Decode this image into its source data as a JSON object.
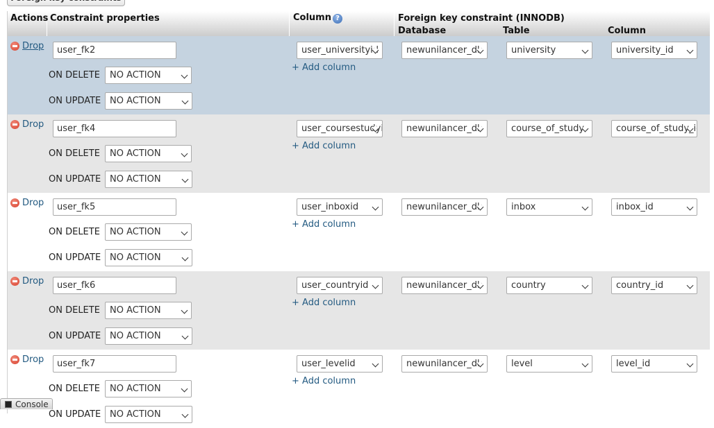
{
  "top_tab_label": "Foreign key constraints",
  "header": {
    "actions": "Actions",
    "constraint_properties": "Constraint properties",
    "column": "Column",
    "fk_title": "Foreign key constraint (INNODB)",
    "database": "Database",
    "table": "Table",
    "ref_column": "Column"
  },
  "labels": {
    "drop": "Drop",
    "on_delete": "ON DELETE",
    "on_update": "ON UPDATE",
    "add_column": "+ Add column"
  },
  "rows": [
    {
      "name": "user_fk2",
      "on_delete": "NO ACTION",
      "on_update": "NO ACTION",
      "column": "user_universityid",
      "database": "newunilancer_db",
      "table": "university",
      "ref_column": "university_id"
    },
    {
      "name": "user_fk4",
      "on_delete": "NO ACTION",
      "on_update": "NO ACTION",
      "column": "user_coursestudyid",
      "database": "newunilancer_db",
      "table": "course_of_study",
      "ref_column": "course_of_study_id"
    },
    {
      "name": "user_fk5",
      "on_delete": "NO ACTION",
      "on_update": "NO ACTION",
      "column": "user_inboxid",
      "database": "newunilancer_db",
      "table": "inbox",
      "ref_column": "inbox_id"
    },
    {
      "name": "user_fk6",
      "on_delete": "NO ACTION",
      "on_update": "NO ACTION",
      "column": "user_countryid",
      "database": "newunilancer_db",
      "table": "country",
      "ref_column": "country_id"
    },
    {
      "name": "user_fk7",
      "on_delete": "NO ACTION",
      "on_update": "NO ACTION",
      "column": "user_levelid",
      "database": "newunilancer_db",
      "table": "level",
      "ref_column": "level_id"
    }
  ],
  "console_label": "Console",
  "colors": {
    "highlight_row": "#c5d3e0",
    "odd_row": "#e6e6e6",
    "link": "#235a81"
  }
}
